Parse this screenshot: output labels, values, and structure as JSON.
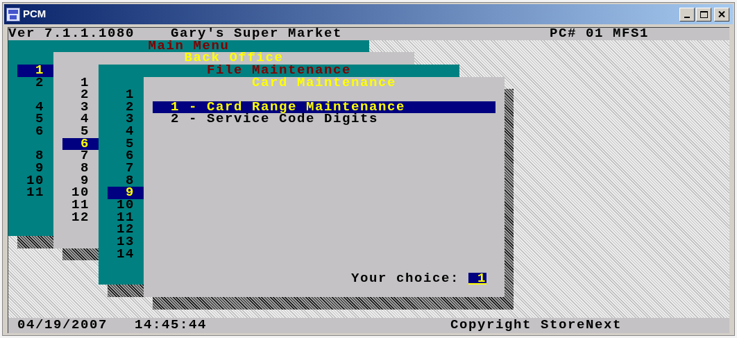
{
  "window": {
    "title": "PCM"
  },
  "header": {
    "version": "Ver 7.1.1.1080",
    "store": "Gary's Super Market",
    "terminal": "PC# 01 MFS1"
  },
  "menus": [
    {
      "title": "Main Menu",
      "kind": "numbers",
      "color": "#008080",
      "items": [
        {
          "kind": "item",
          "label": "1",
          "selected": true
        },
        {
          "kind": "item",
          "label": "2",
          "selected": false
        },
        {
          "kind": "spacer"
        },
        {
          "kind": "item",
          "label": "4",
          "selected": false
        },
        {
          "kind": "item",
          "label": "5",
          "selected": false
        },
        {
          "kind": "item",
          "label": "6",
          "selected": false
        },
        {
          "kind": "spacer"
        },
        {
          "kind": "item",
          "label": "8",
          "selected": false
        },
        {
          "kind": "item",
          "label": "9",
          "selected": false
        },
        {
          "kind": "item",
          "label": "10",
          "selected": false
        },
        {
          "kind": "item",
          "label": "11",
          "selected": false
        }
      ]
    },
    {
      "title": "Back Office",
      "kind": "numbers",
      "color": "#c4c2c4",
      "items": [
        {
          "kind": "item",
          "label": "1",
          "selected": false
        },
        {
          "kind": "item",
          "label": "2",
          "selected": false
        },
        {
          "kind": "item",
          "label": "3",
          "selected": false
        },
        {
          "kind": "item",
          "label": "4",
          "selected": false
        },
        {
          "kind": "item",
          "label": "5",
          "selected": false
        },
        {
          "kind": "item",
          "label": "6",
          "selected": true
        },
        {
          "kind": "item",
          "label": "7",
          "selected": false
        },
        {
          "kind": "item",
          "label": "8",
          "selected": false
        },
        {
          "kind": "item",
          "label": "9",
          "selected": false
        },
        {
          "kind": "item",
          "label": "10",
          "selected": false
        },
        {
          "kind": "item",
          "label": "11",
          "selected": false
        },
        {
          "kind": "item",
          "label": "12",
          "selected": false
        }
      ]
    },
    {
      "title": "File Maintenance",
      "kind": "numbers",
      "color": "#008080",
      "items": [
        {
          "kind": "item",
          "label": "1",
          "selected": false
        },
        {
          "kind": "item",
          "label": "2",
          "selected": false
        },
        {
          "kind": "item",
          "label": "3",
          "selected": false
        },
        {
          "kind": "item",
          "label": "4",
          "selected": false
        },
        {
          "kind": "item",
          "label": "5",
          "selected": false
        },
        {
          "kind": "item",
          "label": "6",
          "selected": false
        },
        {
          "kind": "item",
          "label": "7",
          "selected": false
        },
        {
          "kind": "item",
          "label": "8",
          "selected": false
        },
        {
          "kind": "item",
          "label": "9",
          "selected": true
        },
        {
          "kind": "item",
          "label": "10",
          "selected": false
        },
        {
          "kind": "item",
          "label": "11",
          "selected": false
        },
        {
          "kind": "item",
          "label": "12",
          "selected": false
        },
        {
          "kind": "item",
          "label": "13",
          "selected": false
        },
        {
          "kind": "item",
          "label": "14",
          "selected": false
        }
      ]
    },
    {
      "title": "Card Maintenance",
      "kind": "list",
      "color": "#c4c2c4",
      "items": [
        {
          "kind": "item",
          "label": "1 - Card Range Maintenance",
          "selected": true
        },
        {
          "kind": "item",
          "label": "2 - Service Code Digits",
          "selected": false
        }
      ]
    }
  ],
  "prompt": {
    "label": "Your choice:",
    "value": "1"
  },
  "status_bar": {
    "date": "04/19/2007",
    "time": "14:45:44",
    "copyright": "Copyright StoreNext"
  }
}
